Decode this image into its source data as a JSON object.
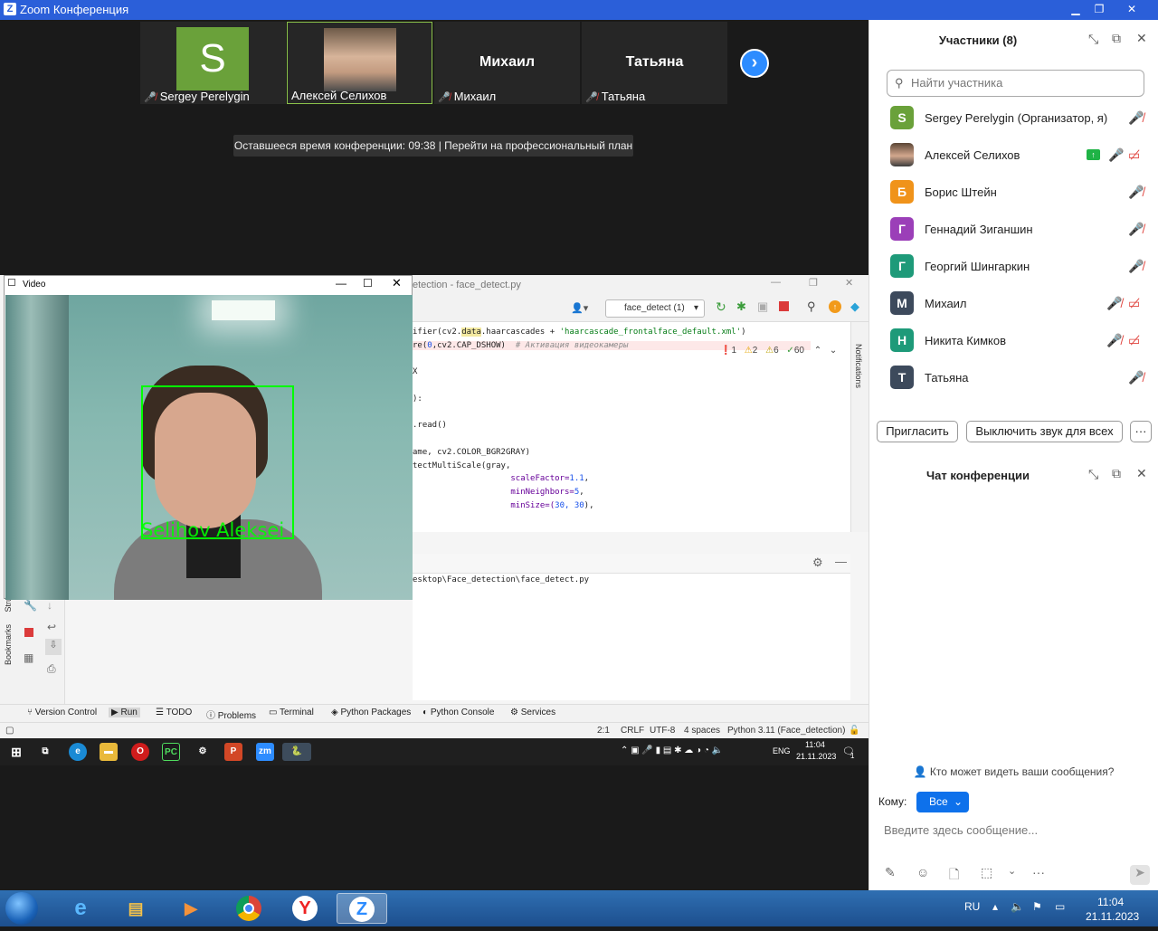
{
  "zoom": {
    "window_title": "Zoom Конференция",
    "tiles": [
      {
        "initial": "S",
        "name": "Sergey Perelygin",
        "muted": true
      },
      {
        "name": "Алексей Селихов",
        "muted": false
      },
      {
        "big_name": "Михаил",
        "name": "Михаил",
        "muted": true
      },
      {
        "big_name": "Татьяна",
        "name": "Татьяна",
        "muted": true
      }
    ],
    "next_label": "›",
    "time_banner": "Оставшееся время конференции: 09:38 | Перейти на профессиональный план"
  },
  "video_window": {
    "title": "Video",
    "face_label": "Selihov Aleksei"
  },
  "pycharm": {
    "title": "etection - face_detect.py",
    "run_config": "face_detect (1)",
    "inspections": {
      "errors": "1",
      "warnings": "2",
      "weak": "6",
      "ok": "60"
    },
    "code": [
      {
        "pre": "ifier(cv2.",
        "attr": "data",
        "mid": ".haarcascades + ",
        "str": "'haarcascade_frontalface_default.xml'",
        "post": ")"
      },
      {
        "pre": "re(",
        "num1": "0",
        "mid": ",cv2.CAP_DSHOW)  ",
        "cmt": "# Активация видеокамеры"
      },
      {
        "text": "X"
      },
      {
        "text": "):"
      },
      {
        "text": ".read()"
      },
      {
        "text": "ame, cv2.COLOR_BGR2GRAY)"
      },
      {
        "text": "tectMultiScale(gray,"
      },
      {
        "indent": "                    ",
        "key": "scaleFactor=",
        "num": "1.1",
        "post": ","
      },
      {
        "indent": "                    ",
        "key": "minNeighbors=",
        "num": "5",
        "post": ","
      },
      {
        "indent": "                    ",
        "key": "minSize=(",
        "num": "30, 30",
        "post": "),"
      }
    ],
    "run_output": "esktop\\Face_detection\\face_detect.py",
    "notifications_label": "Notifications",
    "bookmarks_label": "Bookmarks",
    "structure_label": "Stru",
    "bottom_tabs": [
      "Version Control",
      "Run",
      "TODO",
      "Problems",
      "Terminal",
      "Python Packages",
      "Python Console",
      "Services"
    ],
    "status": {
      "pos": "2:1",
      "eol": "CRLF",
      "enc": "UTF-8",
      "indent": "4 spaces",
      "interp": "Python 3.11 (Face_detection)"
    }
  },
  "inner_taskbar": {
    "lang": "ENG",
    "time": "11:04",
    "date": "21.11.2023",
    "notif_count": "1"
  },
  "participants": {
    "title": "Участники (8)",
    "search_placeholder": "Найти участника",
    "list": [
      {
        "initial": "S",
        "color": "#6aa13a",
        "name": "Sergey Perelygin (Организатор, я)"
      },
      {
        "initial": "",
        "color": "",
        "name": "Алексей Селихов"
      },
      {
        "initial": "Б",
        "color": "#f0931a",
        "name": "Борис Штейн"
      },
      {
        "initial": "Г",
        "color": "#9b3fb8",
        "name": "Геннадий Зиганшин"
      },
      {
        "initial": "Г",
        "color": "#1e9a79",
        "name": "Георгий Шингаркин"
      },
      {
        "initial": "М",
        "color": "#3d4a5c",
        "name": "Михаил"
      },
      {
        "initial": "Н",
        "color": "#1e9a79",
        "name": "Никита Кимков"
      },
      {
        "initial": "Т",
        "color": "#3d4a5c",
        "name": "Татьяна"
      }
    ],
    "invite_label": "Пригласить",
    "mute_all_label": "Выключить звук для всех",
    "more_label": "···"
  },
  "chat": {
    "title": "Чат конференции",
    "who_sees": "Кто может видеть ваши сообщения?",
    "to_label": "Кому:",
    "to_value": "Все",
    "placeholder": "Введите здесь сообщение..."
  },
  "windows_taskbar": {
    "lang": "RU",
    "time": "11:04",
    "date": "21.11.2023"
  }
}
